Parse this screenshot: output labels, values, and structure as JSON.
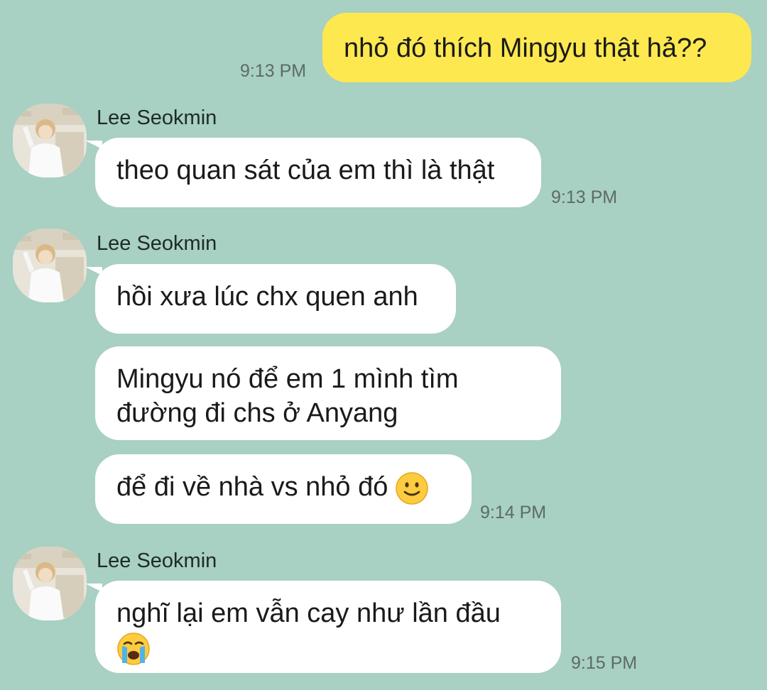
{
  "messages": {
    "m1": {
      "text": "nhỏ đó thích Mingyu thật hả??",
      "time": "9:13 PM"
    },
    "m2": {
      "sender": "Lee Seokmin",
      "text": "theo quan sát của em thì là thật",
      "time": "9:13 PM"
    },
    "m3": {
      "sender": "Lee Seokmin",
      "text": "hồi xưa lúc chx quen anh"
    },
    "m4": {
      "line1": "Mingyu nó để em 1 mình tìm",
      "line2": "đường đi chs ở Anyang"
    },
    "m5": {
      "text": "để đi về nhà vs nhỏ đó",
      "emoji": "slightly-smiling-face",
      "time": "9:14 PM"
    },
    "m6": {
      "sender": "Lee Seokmin",
      "text": "nghĩ lại em vẫn cay như lần đầu",
      "emoji": "loudly-crying-face",
      "time": "9:15 PM"
    }
  },
  "colors": {
    "background": "#a8d0c3",
    "outgoing_bubble": "#fde84f",
    "incoming_bubble": "#ffffff",
    "timestamp": "#5d6b66"
  }
}
